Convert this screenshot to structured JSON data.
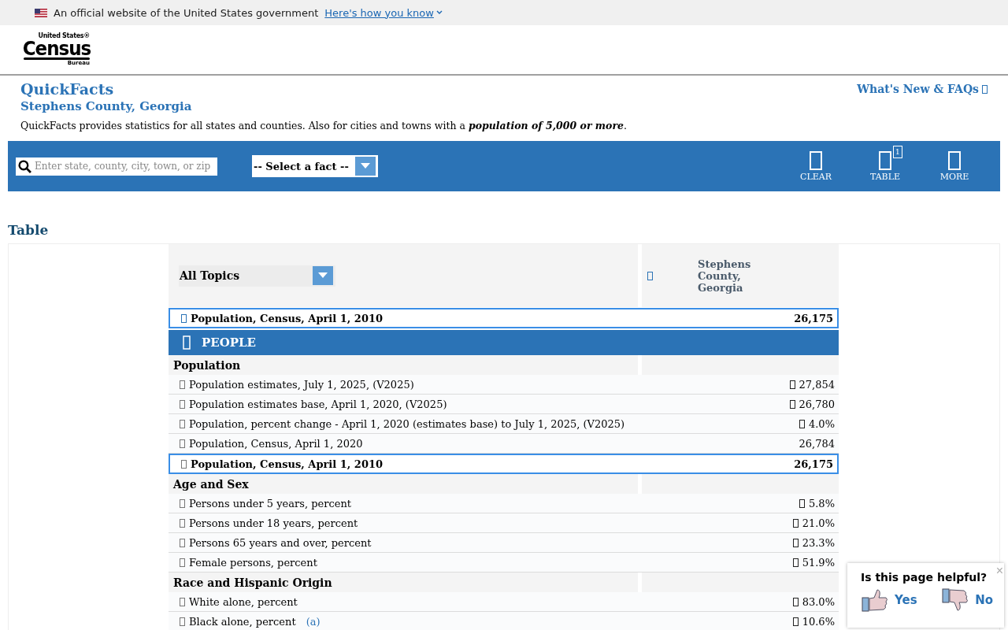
{
  "gov_banner": {
    "text": "An official website of the United States government",
    "link": "Here's how you know"
  },
  "logo": {
    "top": "United States®",
    "main": "Census",
    "bottom": "Bureau"
  },
  "page": {
    "title": "QuickFacts",
    "subtitle": "Stephens County, Georgia",
    "link": "What's New & FAQs",
    "description": "QuickFacts provides statistics for all states and counties. Also for cities and towns with a ",
    "emphasis": "population of 5,000 or more",
    "description_end": "."
  },
  "toolbar": {
    "search": {
      "placeholder": "Enter state, county, city, town, or zip"
    },
    "select": "-- Select a fact --",
    "buttons": [
      {
        "label": "CLEAR"
      },
      {
        "label": "TABLE",
        "badge": "1"
      },
      {
        "label": "MORE"
      }
    ]
  },
  "table": {
    "heading": "Table",
    "topic_select": "All Topics",
    "column_header": "Stephens County, Georgia",
    "pinned": {
      "label": "Population, Census, April 1, 2010",
      "value": "26,175"
    },
    "section": "PEOPLE",
    "rows": [
      {
        "kind": "group",
        "label": "Population"
      },
      {
        "kind": "fact",
        "label": "Population estimates, July 1, 2025, (V2025)",
        "value": "27,854",
        "flagged": true,
        "selected": false
      },
      {
        "kind": "fact",
        "label": "Population estimates base, April 1, 2020, (V2025)",
        "value": "26,780",
        "flagged": true,
        "selected": false
      },
      {
        "kind": "fact",
        "label": "Population, percent change - April 1, 2020 (estimates base) to July 1, 2025, (V2025)",
        "value": "4.0%",
        "flagged": true,
        "selected": false
      },
      {
        "kind": "fact",
        "label": "Population, Census, April 1, 2020",
        "value": "26,784",
        "flagged": false,
        "selected": false
      },
      {
        "kind": "fact",
        "label": "Population, Census, April 1, 2010",
        "value": "26,175",
        "flagged": false,
        "selected": true
      },
      {
        "kind": "group",
        "label": "Age and Sex"
      },
      {
        "kind": "fact",
        "label": "Persons under 5 years, percent",
        "value": "5.8%",
        "flagged": true,
        "selected": false
      },
      {
        "kind": "fact",
        "label": "Persons under 18 years, percent",
        "value": "21.0%",
        "flagged": true,
        "selected": false
      },
      {
        "kind": "fact",
        "label": "Persons 65 years and over, percent",
        "value": "23.3%",
        "flagged": true,
        "selected": false
      },
      {
        "kind": "fact",
        "label": "Female persons, percent",
        "value": "51.9%",
        "flagged": true,
        "selected": false
      },
      {
        "kind": "group",
        "label": "Race and Hispanic Origin"
      },
      {
        "kind": "fact",
        "label": "White alone, percent",
        "value": "83.0%",
        "flagged": true,
        "selected": false
      },
      {
        "kind": "fact",
        "label": "Black alone, percent",
        "note": "(a)",
        "value": "10.6%",
        "flagged": true,
        "selected": false
      }
    ]
  },
  "feedback": {
    "question": "Is this page helpful?",
    "close": "×",
    "yes": "Yes",
    "no": "No"
  }
}
